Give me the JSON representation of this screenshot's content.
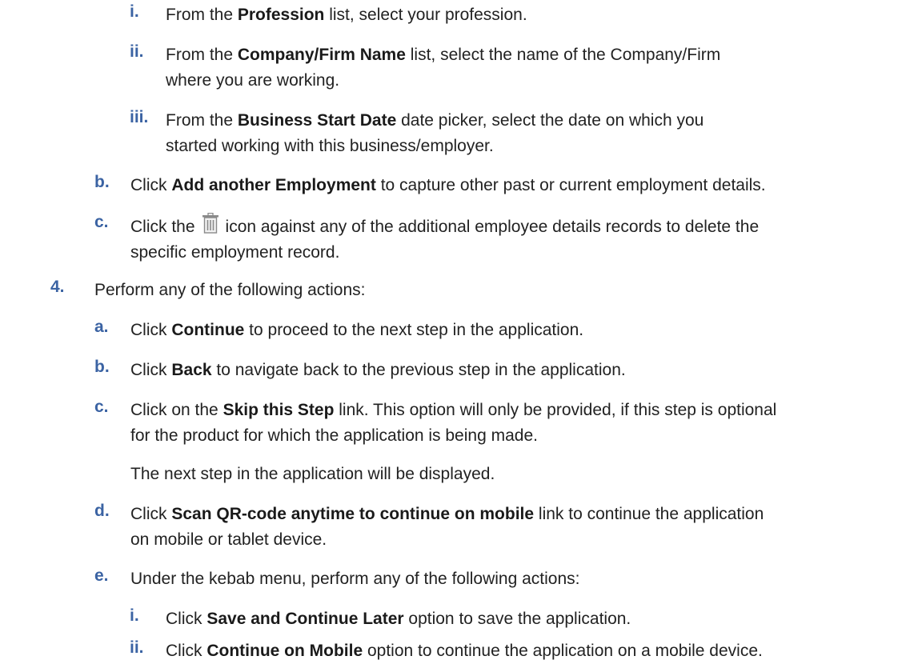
{
  "colors": {
    "marker": "#3b63a3",
    "text": "#222222"
  },
  "steps": {
    "s3a_i": {
      "marker": "i.",
      "pre": "From the ",
      "bold": "Profession",
      "post": " list, select your profession."
    },
    "s3a_ii": {
      "marker": "ii.",
      "pre": "From the ",
      "bold": "Company/Firm Name",
      "post": " list, select the name of the Company/Firm",
      "line2": "where you are working."
    },
    "s3a_iii": {
      "marker": "iii.",
      "pre": "From the ",
      "bold": "Business Start Date",
      "post": " date picker, select the date on which you",
      "line2": "started working with this business/employer."
    },
    "s3b": {
      "marker": "b.",
      "pre": "Click ",
      "bold": "Add another Employment",
      "post": " to capture other past or current employment details."
    },
    "s3c": {
      "marker": "c.",
      "pre": "Click the",
      "icon": "trash-icon",
      "post": "icon against any of the additional employee details records to delete the",
      "line2": "specific employment record."
    },
    "s4": {
      "marker": "4.",
      "text": "Perform any of the following actions:"
    },
    "s4a": {
      "marker": "a.",
      "pre": "Click ",
      "bold": "Continue",
      "post": " to proceed to the next step in the application."
    },
    "s4b": {
      "marker": "b.",
      "pre": "Click ",
      "bold": "Back",
      "post": " to navigate back to the previous step in the application."
    },
    "s4c": {
      "marker": "c.",
      "pre": "Click on the ",
      "bold": "Skip this Step",
      "post": " link. This option will only be provided, if this step is optional",
      "line2": "for the product for which the application is being made."
    },
    "s4c_note": {
      "text": "The next step in the application will be displayed."
    },
    "s4d": {
      "marker": "d.",
      "pre": "Click ",
      "bold": "Scan QR-code anytime to continue on mobile",
      "post": " link to continue the application",
      "line2": "on mobile or tablet device."
    },
    "s4e": {
      "marker": "e.",
      "text": "Under the kebab menu, perform any of the following actions:"
    },
    "s4e_i": {
      "marker": "i.",
      "pre": "Click ",
      "bold": "Save and Continue Later",
      "post": " option to save the application."
    },
    "s4e_ii": {
      "marker": "ii.",
      "pre": "Click ",
      "bold": "Continue on Mobile",
      "post": " option to continue the application on a mobile device."
    }
  }
}
